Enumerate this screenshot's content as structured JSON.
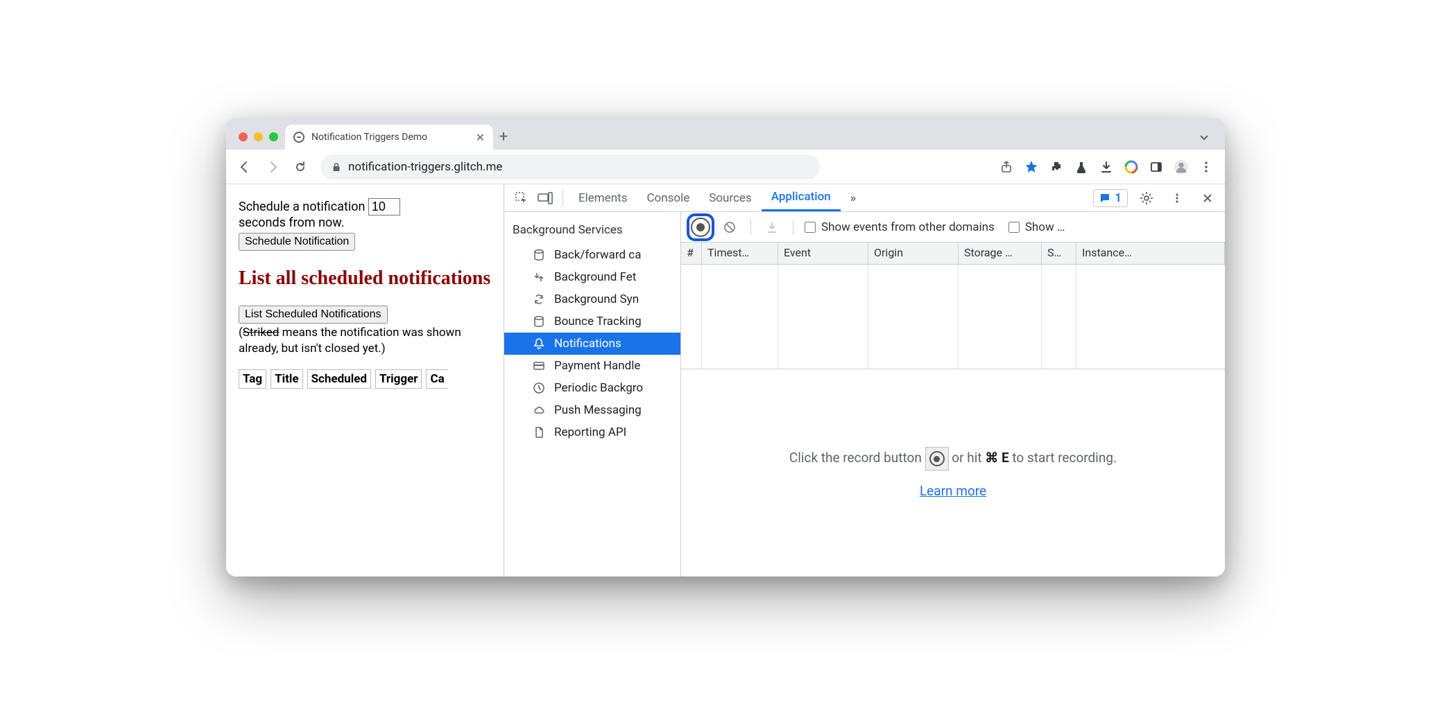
{
  "browser": {
    "tab_title": "Notification Triggers Demo",
    "url": "notification-triggers.glitch.me"
  },
  "page": {
    "schedule_label_pre": "Schedule a notification",
    "schedule_seconds": "10",
    "schedule_label_post": "seconds from now.",
    "schedule_button": "Schedule Notification",
    "heading": "List all scheduled notifications",
    "list_button": "List Scheduled Notifications",
    "note_open": "(",
    "note_striked": "Striked",
    "note_rest": " means the notification was shown already, but isn't closed yet.)",
    "table_headers": [
      "Tag",
      "Title",
      "Scheduled",
      "Trigger",
      "Ca"
    ]
  },
  "devtools": {
    "tabs": [
      "Elements",
      "Console",
      "Sources",
      "Application"
    ],
    "active_tab": "Application",
    "more": "»",
    "issues_count": "1",
    "sidebar": {
      "group": "Background Services",
      "items": [
        "Back/forward ca",
        "Background Fet",
        "Background Syn",
        "Bounce Tracking",
        "Notifications",
        "Payment Handle",
        "Periodic Backgro",
        "Push Messaging",
        "Reporting API"
      ],
      "selected_index": 4
    },
    "toolbar2": {
      "show_other_domains": "Show events from other domains",
      "show_truncated": "Show …"
    },
    "columns": [
      "#",
      "Timest…",
      "Event",
      "Origin",
      "Storage …",
      "S…",
      "Instance…"
    ],
    "empty": {
      "pre": "Click the record button ",
      "mid": " or hit ",
      "shortcut": "⌘ E",
      "post": " to start recording.",
      "learn": "Learn more"
    }
  }
}
